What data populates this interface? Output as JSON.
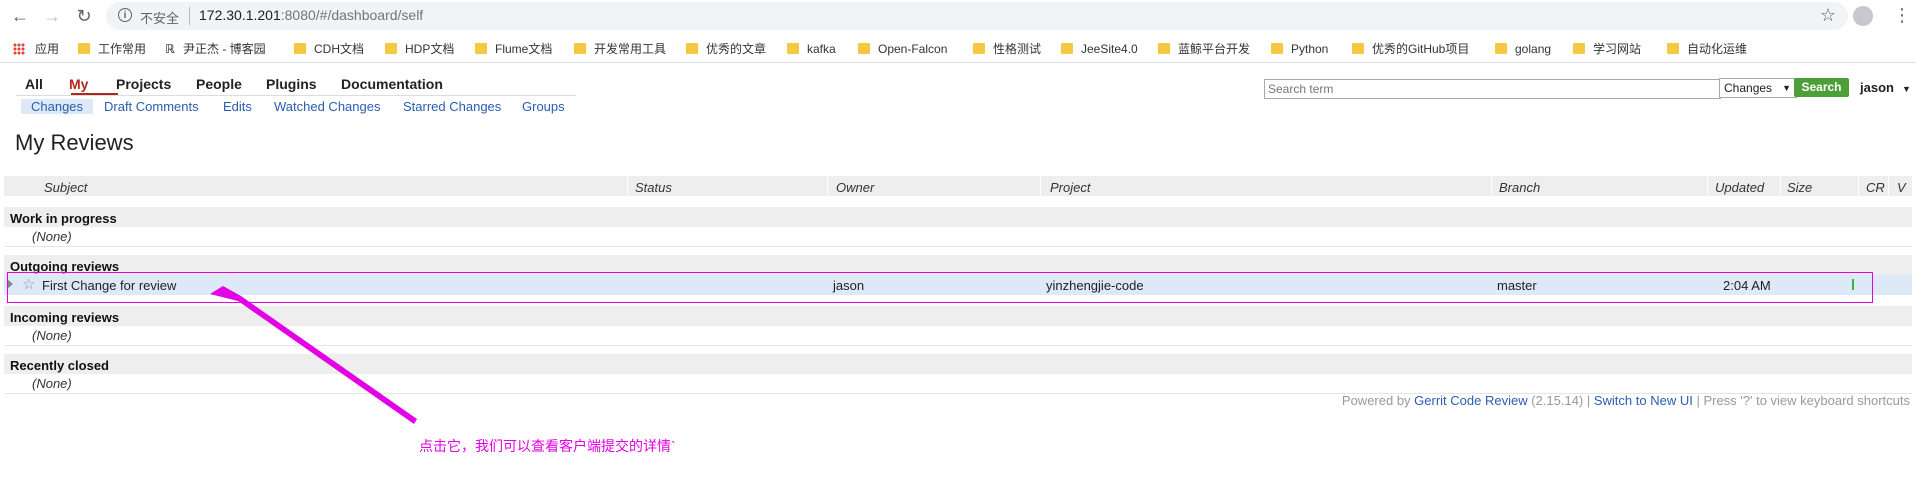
{
  "browser": {
    "url_security": "不安全",
    "url_host": "172.30.1.201",
    "url_rest": ":8080/#/dashboard/self",
    "bookmarks": [
      {
        "label": "应用",
        "icon": "apps-grid-icon"
      },
      {
        "label": "工作常用",
        "icon": "folder-icon"
      },
      {
        "label": "尹正杰 - 博客园",
        "icon": "blog-icon"
      },
      {
        "label": "CDH文档",
        "icon": "folder-icon"
      },
      {
        "label": "HDP文档",
        "icon": "folder-icon"
      },
      {
        "label": "Flume文档",
        "icon": "folder-icon"
      },
      {
        "label": "开发常用工具",
        "icon": "folder-icon"
      },
      {
        "label": "优秀的文章",
        "icon": "folder-icon"
      },
      {
        "label": "kafka",
        "icon": "folder-icon"
      },
      {
        "label": "Open-Falcon",
        "icon": "folder-icon"
      },
      {
        "label": "性格测试",
        "icon": "folder-icon"
      },
      {
        "label": "JeeSite4.0",
        "icon": "folder-icon"
      },
      {
        "label": "蓝鲸平台开发",
        "icon": "folder-icon"
      },
      {
        "label": "Python",
        "icon": "folder-icon"
      },
      {
        "label": "优秀的GitHub项目",
        "icon": "folder-icon"
      },
      {
        "label": "golang",
        "icon": "folder-icon"
      },
      {
        "label": "学习网站",
        "icon": "folder-icon"
      },
      {
        "label": "自动化运维",
        "icon": "folder-icon"
      }
    ]
  },
  "gerrit": {
    "top_menu": [
      "All",
      "My",
      "Projects",
      "People",
      "Plugins",
      "Documentation"
    ],
    "active_top": "My",
    "sub_menu": [
      "Changes",
      "Draft Comments",
      "Edits",
      "Watched Changes",
      "Starred Changes",
      "Groups"
    ],
    "active_sub": "Changes",
    "search": {
      "placeholder": "Search term",
      "scope": "Changes",
      "button": "Search"
    },
    "user": "jason",
    "page_title": "My Reviews",
    "columns": [
      "Subject",
      "Status",
      "Owner",
      "Project",
      "Branch",
      "Updated",
      "Size",
      "CR",
      "V"
    ],
    "sections": [
      {
        "title": "Work in progress",
        "empty": "(None)"
      },
      {
        "title": "Outgoing reviews"
      },
      {
        "title": "Incoming reviews",
        "empty": "(None)"
      },
      {
        "title": "Recently closed",
        "empty": "(None)"
      }
    ],
    "change": {
      "subject": "First Change for review",
      "status": "",
      "owner": "jason",
      "project": "yinzhengjie-code",
      "branch": "master",
      "updated": "2:04 AM"
    },
    "footer": {
      "powered_by": "Powered by ",
      "product": "Gerrit Code Review",
      "version": " (2.15.14) | ",
      "switch_ui": "Switch to New UI",
      "shortcuts": " | Press '?' to view keyboard shortcuts"
    },
    "annotation": "点击它，我们可以查看客户端提交的详情`"
  },
  "colors": {
    "accent": "#b5261e",
    "link": "#2a5db0",
    "search_button": "#4d9f3a",
    "annotation": "#e400e4"
  }
}
